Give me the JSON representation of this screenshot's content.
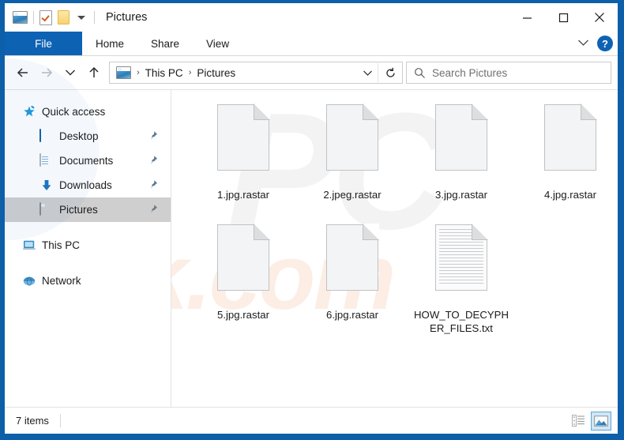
{
  "window": {
    "title": "Pictures",
    "quick_access": [
      {
        "name": "pictures-icon",
        "label": "Pictures"
      },
      {
        "name": "properties-icon",
        "label": "Properties"
      },
      {
        "name": "new-folder-icon",
        "label": "New folder"
      },
      {
        "name": "customize-dropdown-icon",
        "label": "Customize Quick Access Toolbar"
      }
    ],
    "controls": {
      "minimize": "─",
      "maximize": "□",
      "close": "✕"
    }
  },
  "ribbon": {
    "tabs": [
      {
        "label": "File",
        "active": true
      },
      {
        "label": "Home",
        "active": false
      },
      {
        "label": "Share",
        "active": false
      },
      {
        "label": "View",
        "active": false
      }
    ],
    "expand_label": "Expand the Ribbon",
    "help_label": "?"
  },
  "navigation": {
    "back_label": "Back",
    "forward_label": "Forward",
    "recent_label": "Recent locations",
    "up_label": "Up",
    "breadcrumb": [
      "This PC",
      "Pictures"
    ],
    "breadcrumb_separator": "›",
    "refresh_label": "Refresh",
    "address_dropdown_label": "Previous locations"
  },
  "search": {
    "placeholder": "Search Pictures",
    "value": ""
  },
  "sidebar": {
    "items": [
      {
        "label": "Quick access",
        "icon": "star-pin-icon",
        "level": "root",
        "pinned": false,
        "selected": false
      },
      {
        "label": "Desktop",
        "icon": "desktop-icon",
        "level": "child",
        "pinned": true,
        "selected": false
      },
      {
        "label": "Documents",
        "icon": "documents-icon",
        "level": "child",
        "pinned": true,
        "selected": false
      },
      {
        "label": "Downloads",
        "icon": "downloads-icon",
        "level": "child",
        "pinned": true,
        "selected": false
      },
      {
        "label": "Pictures",
        "icon": "pictures-icon",
        "level": "child",
        "pinned": true,
        "selected": true
      },
      {
        "label": "This PC",
        "icon": "this-pc-icon",
        "level": "root",
        "pinned": false,
        "selected": false
      },
      {
        "label": "Network",
        "icon": "network-icon",
        "level": "root",
        "pinned": false,
        "selected": false
      }
    ]
  },
  "files": [
    {
      "name": "1.jpg.rastar",
      "type": "blank-file"
    },
    {
      "name": "2.jpeg.rastar",
      "type": "blank-file"
    },
    {
      "name": "3.jpg.rastar",
      "type": "blank-file"
    },
    {
      "name": "4.jpg.rastar",
      "type": "blank-file"
    },
    {
      "name": "5.jpg.rastar",
      "type": "blank-file"
    },
    {
      "name": "6.jpg.rastar",
      "type": "blank-file"
    },
    {
      "name": "HOW_TO_DECYPHER_FILES.txt",
      "type": "text-file"
    }
  ],
  "status": {
    "item_count": "7 items",
    "views": [
      {
        "name": "details-view",
        "label": "Display the items by using details view",
        "active": false
      },
      {
        "name": "large-icons-view",
        "label": "Display the items by using large thumbnails",
        "active": true
      }
    ]
  },
  "watermark": {
    "primary": "PC",
    "secondary": "risk.com"
  },
  "colors": {
    "window_border": "#0c5fa8",
    "accent": "#0d62b4",
    "selection": "#cfcfcf",
    "view_active": "#cfe6f7"
  }
}
